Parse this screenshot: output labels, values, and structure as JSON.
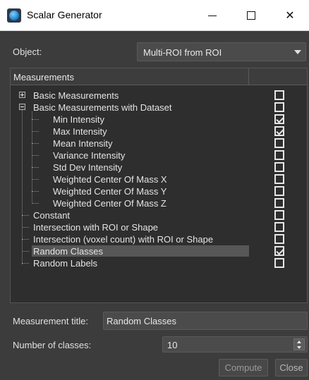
{
  "window": {
    "title": "Scalar Generator",
    "minimize_icon": "minimize-icon",
    "maximize_icon": "maximize-icon",
    "close_glyph": "✕"
  },
  "object": {
    "label": "Object:",
    "selected": "Multi-ROI from ROI"
  },
  "measurements": {
    "header": "Measurements",
    "items": [
      {
        "label": "Basic Measurements",
        "level": 0,
        "expander": "plus",
        "checked": false
      },
      {
        "label": "Basic Measurements with Dataset",
        "level": 0,
        "expander": "minus",
        "checked": false
      },
      {
        "label": "Min Intensity",
        "level": 1,
        "checked": true
      },
      {
        "label": "Max Intensity",
        "level": 1,
        "checked": true
      },
      {
        "label": "Mean Intensity",
        "level": 1,
        "checked": false
      },
      {
        "label": "Variance Intensity",
        "level": 1,
        "checked": false
      },
      {
        "label": "Std Dev Intensity",
        "level": 1,
        "checked": false
      },
      {
        "label": "Weighted Center Of Mass X",
        "level": 1,
        "checked": false
      },
      {
        "label": "Weighted Center Of Mass Y",
        "level": 1,
        "checked": false
      },
      {
        "label": "Weighted Center Of Mass Z",
        "level": 1,
        "checked": false
      },
      {
        "label": "Constant",
        "level": 0,
        "checked": false
      },
      {
        "label": "Intersection with ROI or Shape",
        "level": 0,
        "checked": false
      },
      {
        "label": "Intersection (voxel count) with ROI or Shape",
        "level": 0,
        "checked": false
      },
      {
        "label": "Random Classes",
        "level": 0,
        "checked": true,
        "selected": true
      },
      {
        "label": "Random Labels",
        "level": 0,
        "checked": false
      }
    ]
  },
  "measurement_title": {
    "label": "Measurement title:",
    "value": "Random Classes"
  },
  "number_of_classes": {
    "label": "Number of classes:",
    "value": "10"
  },
  "buttons": {
    "compute": "Compute",
    "close": "Close"
  },
  "colors": {
    "background": "#3c3c3c",
    "panel": "#2e2e2e",
    "selection": "#575757",
    "text": "#e8e8e8"
  }
}
